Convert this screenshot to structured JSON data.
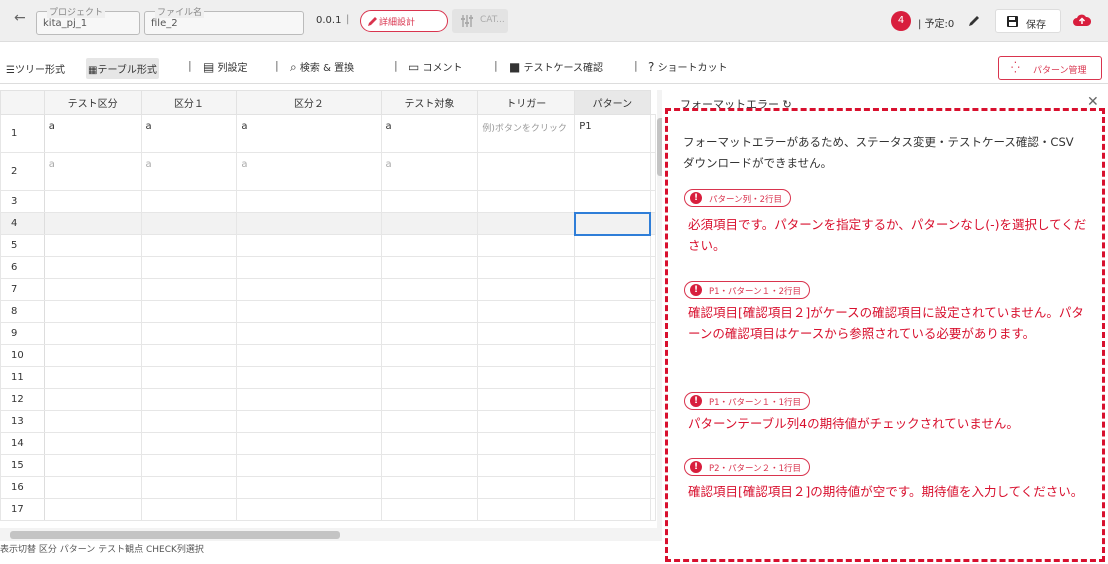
{
  "topbar": {
    "back_icon": "arrow-left-icon",
    "project_label": "プロジェクト",
    "project_value": "kita_pj_1",
    "file_label": "ファイル名",
    "file_value": "file_2",
    "version": "0.0.1",
    "separator": "|",
    "detail_button": "詳細設計",
    "cat_button": "CAT...",
    "badge_count": "4",
    "plan_text": "| 予定:0",
    "save_button": "保存"
  },
  "toolbar": {
    "tree_view": "ツリー形式",
    "table_view": "テーブル形式",
    "column_settings": "列設定",
    "search_replace": "検索 & 置換",
    "comment": "コメント",
    "testcase_check": "テストケース確認",
    "shortcut": "ショートカット",
    "pattern_manage": "パターン管理"
  },
  "grid": {
    "headers": [
      "テスト区分",
      "区分１",
      "区分２",
      "テスト対象",
      "トリガー",
      "パターン"
    ],
    "rows": [
      {
        "num": "1",
        "cells": [
          "a",
          "a",
          "a",
          "a",
          "例)ボタンをクリック",
          "P1"
        ]
      },
      {
        "num": "2",
        "cells": [
          "a",
          "a",
          "a",
          "a",
          "",
          ""
        ]
      },
      {
        "num": "3",
        "cells": [
          "",
          "",
          "",
          "",
          "",
          ""
        ]
      },
      {
        "num": "4",
        "cells": [
          "",
          "",
          "",
          "",
          "",
          ""
        ]
      },
      {
        "num": "5",
        "cells": [
          "",
          "",
          "",
          "",
          "",
          ""
        ]
      },
      {
        "num": "6",
        "cells": [
          "",
          "",
          "",
          "",
          "",
          ""
        ]
      },
      {
        "num": "7",
        "cells": [
          "",
          "",
          "",
          "",
          "",
          ""
        ]
      },
      {
        "num": "8",
        "cells": [
          "",
          "",
          "",
          "",
          "",
          ""
        ]
      },
      {
        "num": "9",
        "cells": [
          "",
          "",
          "",
          "",
          "",
          ""
        ]
      },
      {
        "num": "10",
        "cells": [
          "",
          "",
          "",
          "",
          "",
          ""
        ]
      },
      {
        "num": "11",
        "cells": [
          "",
          "",
          "",
          "",
          "",
          ""
        ]
      },
      {
        "num": "12",
        "cells": [
          "",
          "",
          "",
          "",
          "",
          ""
        ]
      },
      {
        "num": "13",
        "cells": [
          "",
          "",
          "",
          "",
          "",
          ""
        ]
      },
      {
        "num": "14",
        "cells": [
          "",
          "",
          "",
          "",
          "",
          ""
        ]
      },
      {
        "num": "15",
        "cells": [
          "",
          "",
          "",
          "",
          "",
          ""
        ]
      },
      {
        "num": "16",
        "cells": [
          "",
          "",
          "",
          "",
          "",
          ""
        ]
      },
      {
        "num": "17",
        "cells": [
          "",
          "",
          "",
          "",
          "",
          ""
        ]
      }
    ]
  },
  "bottom_bar": "表示切替  区分  パターン  テスト観点  CHECK列選択",
  "error_panel": {
    "title": "フォーマットエラー",
    "intro": "フォーマットエラーがあるため、ステータス変更・テストケース確認・CSVダウンロードができません。",
    "errors": [
      {
        "tag": "パターン列・2行目",
        "message": "必須項目です。パターンを指定するか、パターンなし(-)を選択してください。"
      },
      {
        "tag": "P1・パターン１・2行目",
        "message": "確認項目[確認項目２]がケースの確認項目に設定されていません。パターンの確認項目はケースから参照されている必要があります。"
      },
      {
        "tag": "P1・パターン１・1行目",
        "message": "パターンテーブル列4の期待値がチェックされていません。"
      },
      {
        "tag": "P2・パターン２・1行目",
        "message": "確認項目[確認項目２]の期待値が空です。期待値を入力してください。"
      }
    ]
  },
  "colors": {
    "accent": "#d81e3d",
    "selection": "#2f7ed8"
  }
}
